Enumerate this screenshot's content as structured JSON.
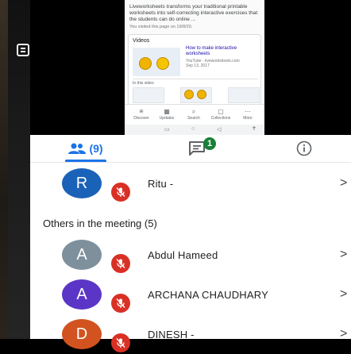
{
  "shared_screen": {
    "snippet": "Liveworksheets transforms your traditional printable worksheets into self-correcting interactive exercises that the students can do online ...",
    "visited": "You visited this page on 19/8/20.",
    "videos_heading": "Videos",
    "video_title": "How to make interactive worksheets",
    "video_source": "YouTube · liveworksheets.com",
    "video_date": "Sep 13, 2017",
    "in_this_video": "In this video",
    "nav": [
      {
        "label": "Discover",
        "icon": "asterisk-icon"
      },
      {
        "label": "Updates",
        "icon": "updates-icon"
      },
      {
        "label": "Search",
        "icon": "search-icon"
      },
      {
        "label": "Collections",
        "icon": "collections-icon"
      },
      {
        "label": "More",
        "icon": "more-icon"
      }
    ]
  },
  "tabs": {
    "people_count": "(9)",
    "chat_badge": "1"
  },
  "participants": {
    "pinned": {
      "initial": "R",
      "name": "Ritu -",
      "color": "#1a62b8"
    },
    "section_title": "Others in the meeting (5)",
    "others": [
      {
        "initial": "A",
        "name": "Abdul Hameed",
        "color": "#7e909c"
      },
      {
        "initial": "A",
        "name": "ARCHANA CHAUDHARY",
        "color": "#5b36c6"
      },
      {
        "initial": "D",
        "name": "DINESH -",
        "color": "#d2531f"
      }
    ]
  },
  "colors": {
    "accent": "#1a73e8",
    "muted": "#d93025",
    "badge": "#188038"
  }
}
